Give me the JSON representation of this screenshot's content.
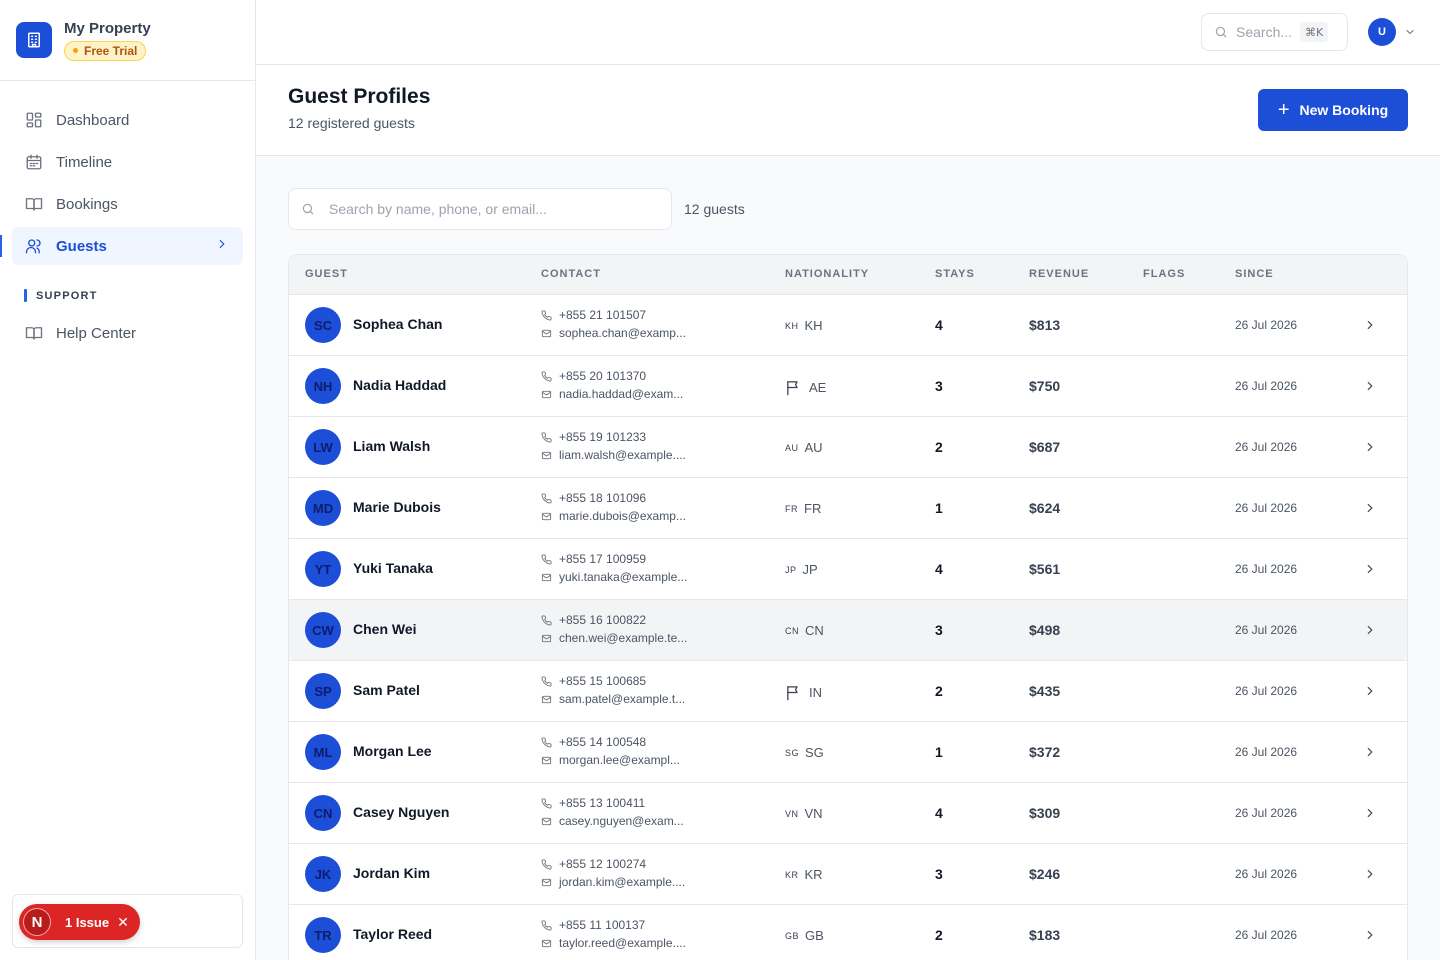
{
  "brand": {
    "name": "My Property",
    "badge": "Free Trial"
  },
  "nav": {
    "items": [
      {
        "label": "Dashboard",
        "icon": "dashboard-grid-icon"
      },
      {
        "label": "Timeline",
        "icon": "calendar-icon"
      },
      {
        "label": "Bookings",
        "icon": "book-icon"
      },
      {
        "label": "Guests",
        "icon": "users-icon",
        "active": true
      }
    ],
    "support_label": "SUPPORT",
    "support_items": [
      {
        "label": "Help Center",
        "icon": "book-icon"
      }
    ]
  },
  "issues": {
    "letter": "N",
    "label": "1 Issue"
  },
  "topbar": {
    "search_placeholder": "Search...",
    "shortcut": "⌘K",
    "avatar_initial": "U"
  },
  "page": {
    "title": "Guest Profiles",
    "subtitle": "12 registered guests",
    "new_booking_label": "New Booking"
  },
  "list": {
    "search_placeholder": "Search by name, phone, or email...",
    "count_label": "12 guests"
  },
  "table": {
    "headers": {
      "guest": "GUEST",
      "contact": "CONTACT",
      "nationality": "NATIONALITY",
      "stays": "STAYS",
      "revenue": "REVENUE",
      "flags": "FLAGS",
      "since": "SINCE"
    },
    "rows": [
      {
        "initials": "SC",
        "name": "Sophea Chan",
        "phone": "+855 21 101507",
        "email": "sophea.chan@examp...",
        "nat_code": "KH",
        "nat": "KH",
        "flag": false,
        "stays": "4",
        "revenue": "$813",
        "since": "26 Jul 2026"
      },
      {
        "initials": "NH",
        "name": "Nadia Haddad",
        "phone": "+855 20 101370",
        "email": "nadia.haddad@exam...",
        "nat_code": "",
        "nat": "AE",
        "flag": true,
        "stays": "3",
        "revenue": "$750",
        "since": "26 Jul 2026"
      },
      {
        "initials": "LW",
        "name": "Liam Walsh",
        "phone": "+855 19 101233",
        "email": "liam.walsh@example....",
        "nat_code": "AU",
        "nat": "AU",
        "flag": false,
        "stays": "2",
        "revenue": "$687",
        "since": "26 Jul 2026"
      },
      {
        "initials": "MD",
        "name": "Marie Dubois",
        "phone": "+855 18 101096",
        "email": "marie.dubois@examp...",
        "nat_code": "FR",
        "nat": "FR",
        "flag": false,
        "stays": "1",
        "revenue": "$624",
        "since": "26 Jul 2026"
      },
      {
        "initials": "YT",
        "name": "Yuki Tanaka",
        "phone": "+855 17 100959",
        "email": "yuki.tanaka@example...",
        "nat_code": "JP",
        "nat": "JP",
        "flag": false,
        "stays": "4",
        "revenue": "$561",
        "since": "26 Jul 2026"
      },
      {
        "initials": "CW",
        "name": "Chen Wei",
        "phone": "+855 16 100822",
        "email": "chen.wei@example.te...",
        "nat_code": "CN",
        "nat": "CN",
        "flag": false,
        "stays": "3",
        "revenue": "$498",
        "since": "26 Jul 2026",
        "hover": true
      },
      {
        "initials": "SP",
        "name": "Sam Patel",
        "phone": "+855 15 100685",
        "email": "sam.patel@example.t...",
        "nat_code": "",
        "nat": "IN",
        "flag": true,
        "stays": "2",
        "revenue": "$435",
        "since": "26 Jul 2026"
      },
      {
        "initials": "ML",
        "name": "Morgan Lee",
        "phone": "+855 14 100548",
        "email": "morgan.lee@exampl...",
        "nat_code": "SG",
        "nat": "SG",
        "flag": false,
        "stays": "1",
        "revenue": "$372",
        "since": "26 Jul 2026"
      },
      {
        "initials": "CN",
        "name": "Casey Nguyen",
        "phone": "+855 13 100411",
        "email": "casey.nguyen@exam...",
        "nat_code": "VN",
        "nat": "VN",
        "flag": false,
        "stays": "4",
        "revenue": "$309",
        "since": "26 Jul 2026"
      },
      {
        "initials": "JK",
        "name": "Jordan Kim",
        "phone": "+855 12 100274",
        "email": "jordan.kim@example....",
        "nat_code": "KR",
        "nat": "KR",
        "flag": false,
        "stays": "3",
        "revenue": "$246",
        "since": "26 Jul 2026"
      },
      {
        "initials": "TR",
        "name": "Taylor Reed",
        "phone": "+855 11 100137",
        "email": "taylor.reed@example....",
        "nat_code": "GB",
        "nat": "GB",
        "flag": false,
        "stays": "2",
        "revenue": "$183",
        "since": "26 Jul 2026"
      }
    ]
  },
  "colors": {
    "accent": "#1d4ed8",
    "badge_bg": "#fef3c7",
    "issue_red": "#dc2626"
  }
}
